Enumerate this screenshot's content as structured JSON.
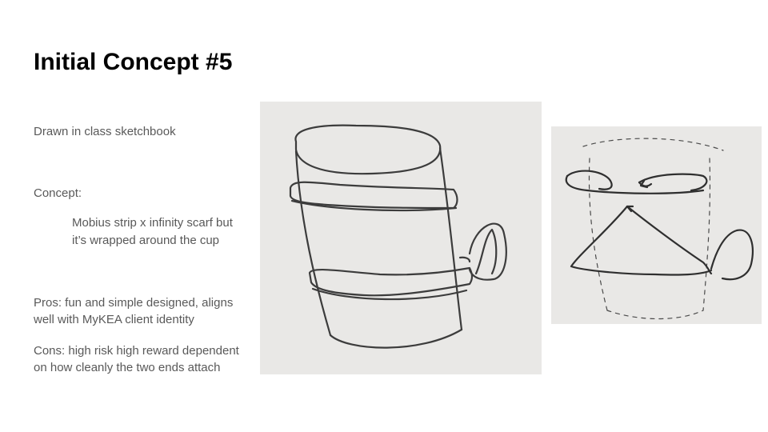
{
  "slide": {
    "title": "Initial Concept #5",
    "drawn_note": "Drawn in class sketchbook",
    "concept_heading": "Concept:",
    "concept_line1": "Mobius strip x infinity scarf but",
    "concept_line2": "it’s wrapped around the cup",
    "pros_line1": "Pros: fun and simple designed, aligns",
    "pros_line2": "well with MyKEA client identity",
    "cons_line1": "Cons: high risk high reward dependent",
    "cons_line2": "on how cleanly the two ends attach"
  },
  "colors": {
    "paper": "#e9e8e6",
    "pencil": "#3c3c3c",
    "body_text": "#595959",
    "title_text": "#000000"
  }
}
